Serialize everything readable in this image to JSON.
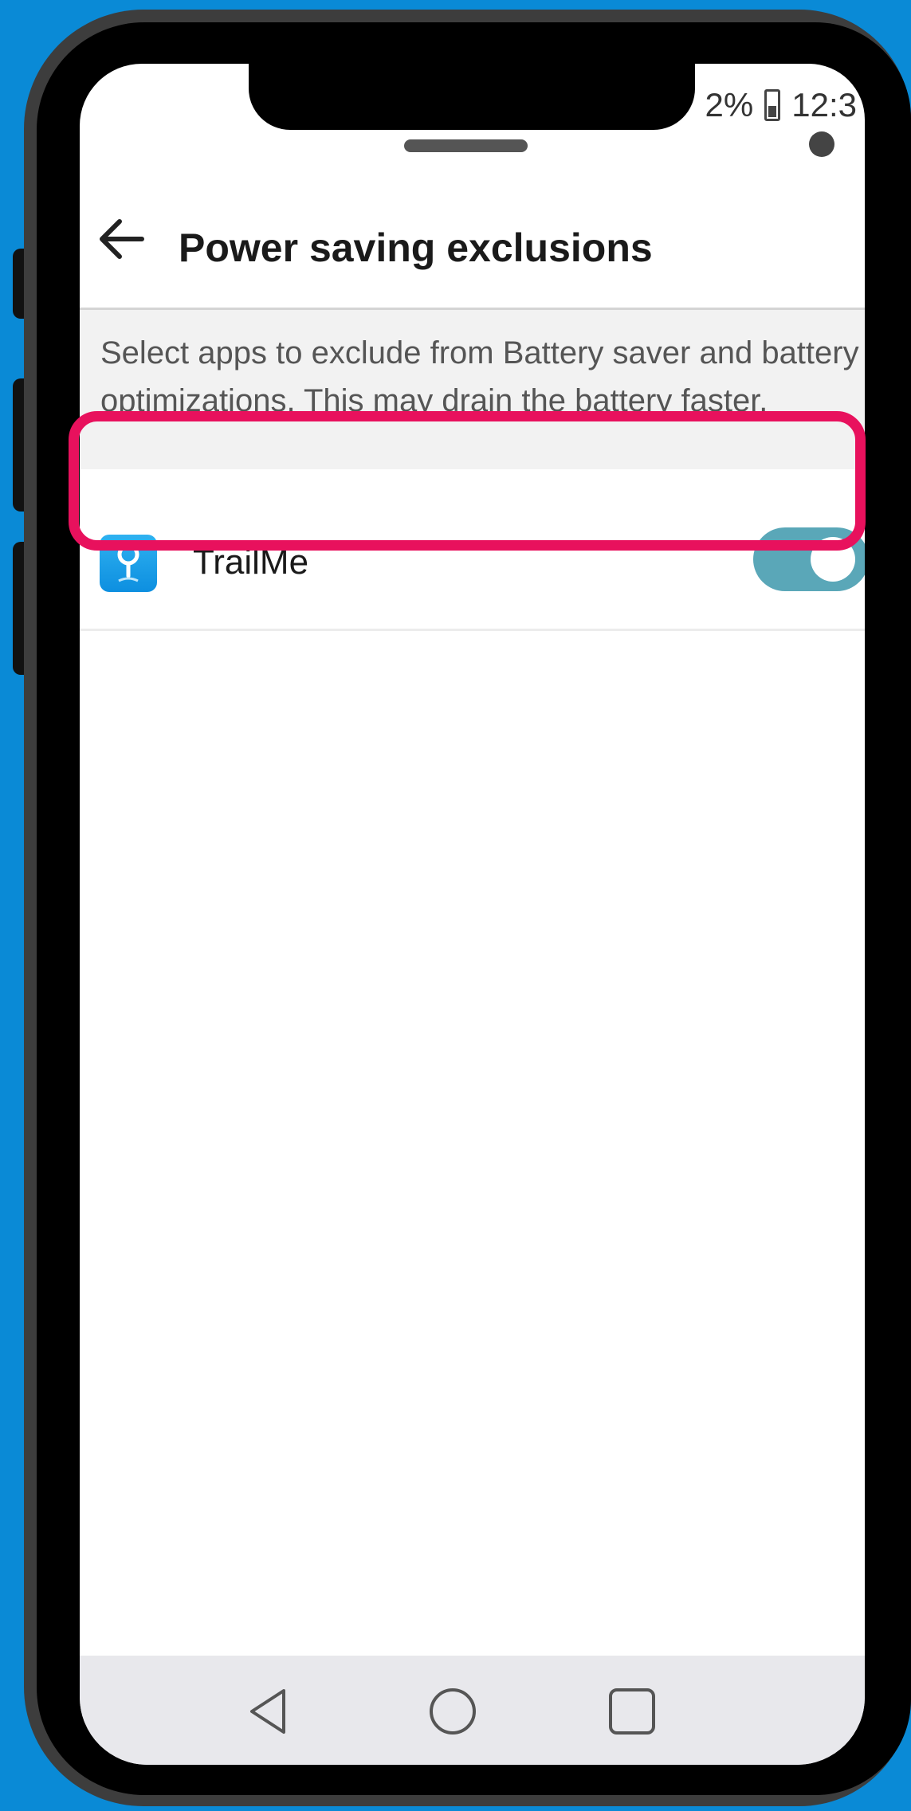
{
  "status_bar": {
    "battery_percent": "2%",
    "time": "12:3"
  },
  "appbar": {
    "title": "Power saving exclusions",
    "back_icon": "back-arrow-icon"
  },
  "description": "Select apps to exclude from Battery saver and battery optimizations. This may drain the battery faster.",
  "apps": [
    {
      "name": "TrailMe",
      "icon": "location-pin-icon",
      "excluded": true
    }
  ],
  "navbar": {
    "buttons": [
      "back-triangle-icon",
      "home-circle-icon",
      "recents-square-icon"
    ]
  },
  "colors": {
    "background": "#0a8ad6",
    "highlight": "#e8115d",
    "toggle_on": "#5aa7b8",
    "app_icon": "#1e9fea"
  }
}
